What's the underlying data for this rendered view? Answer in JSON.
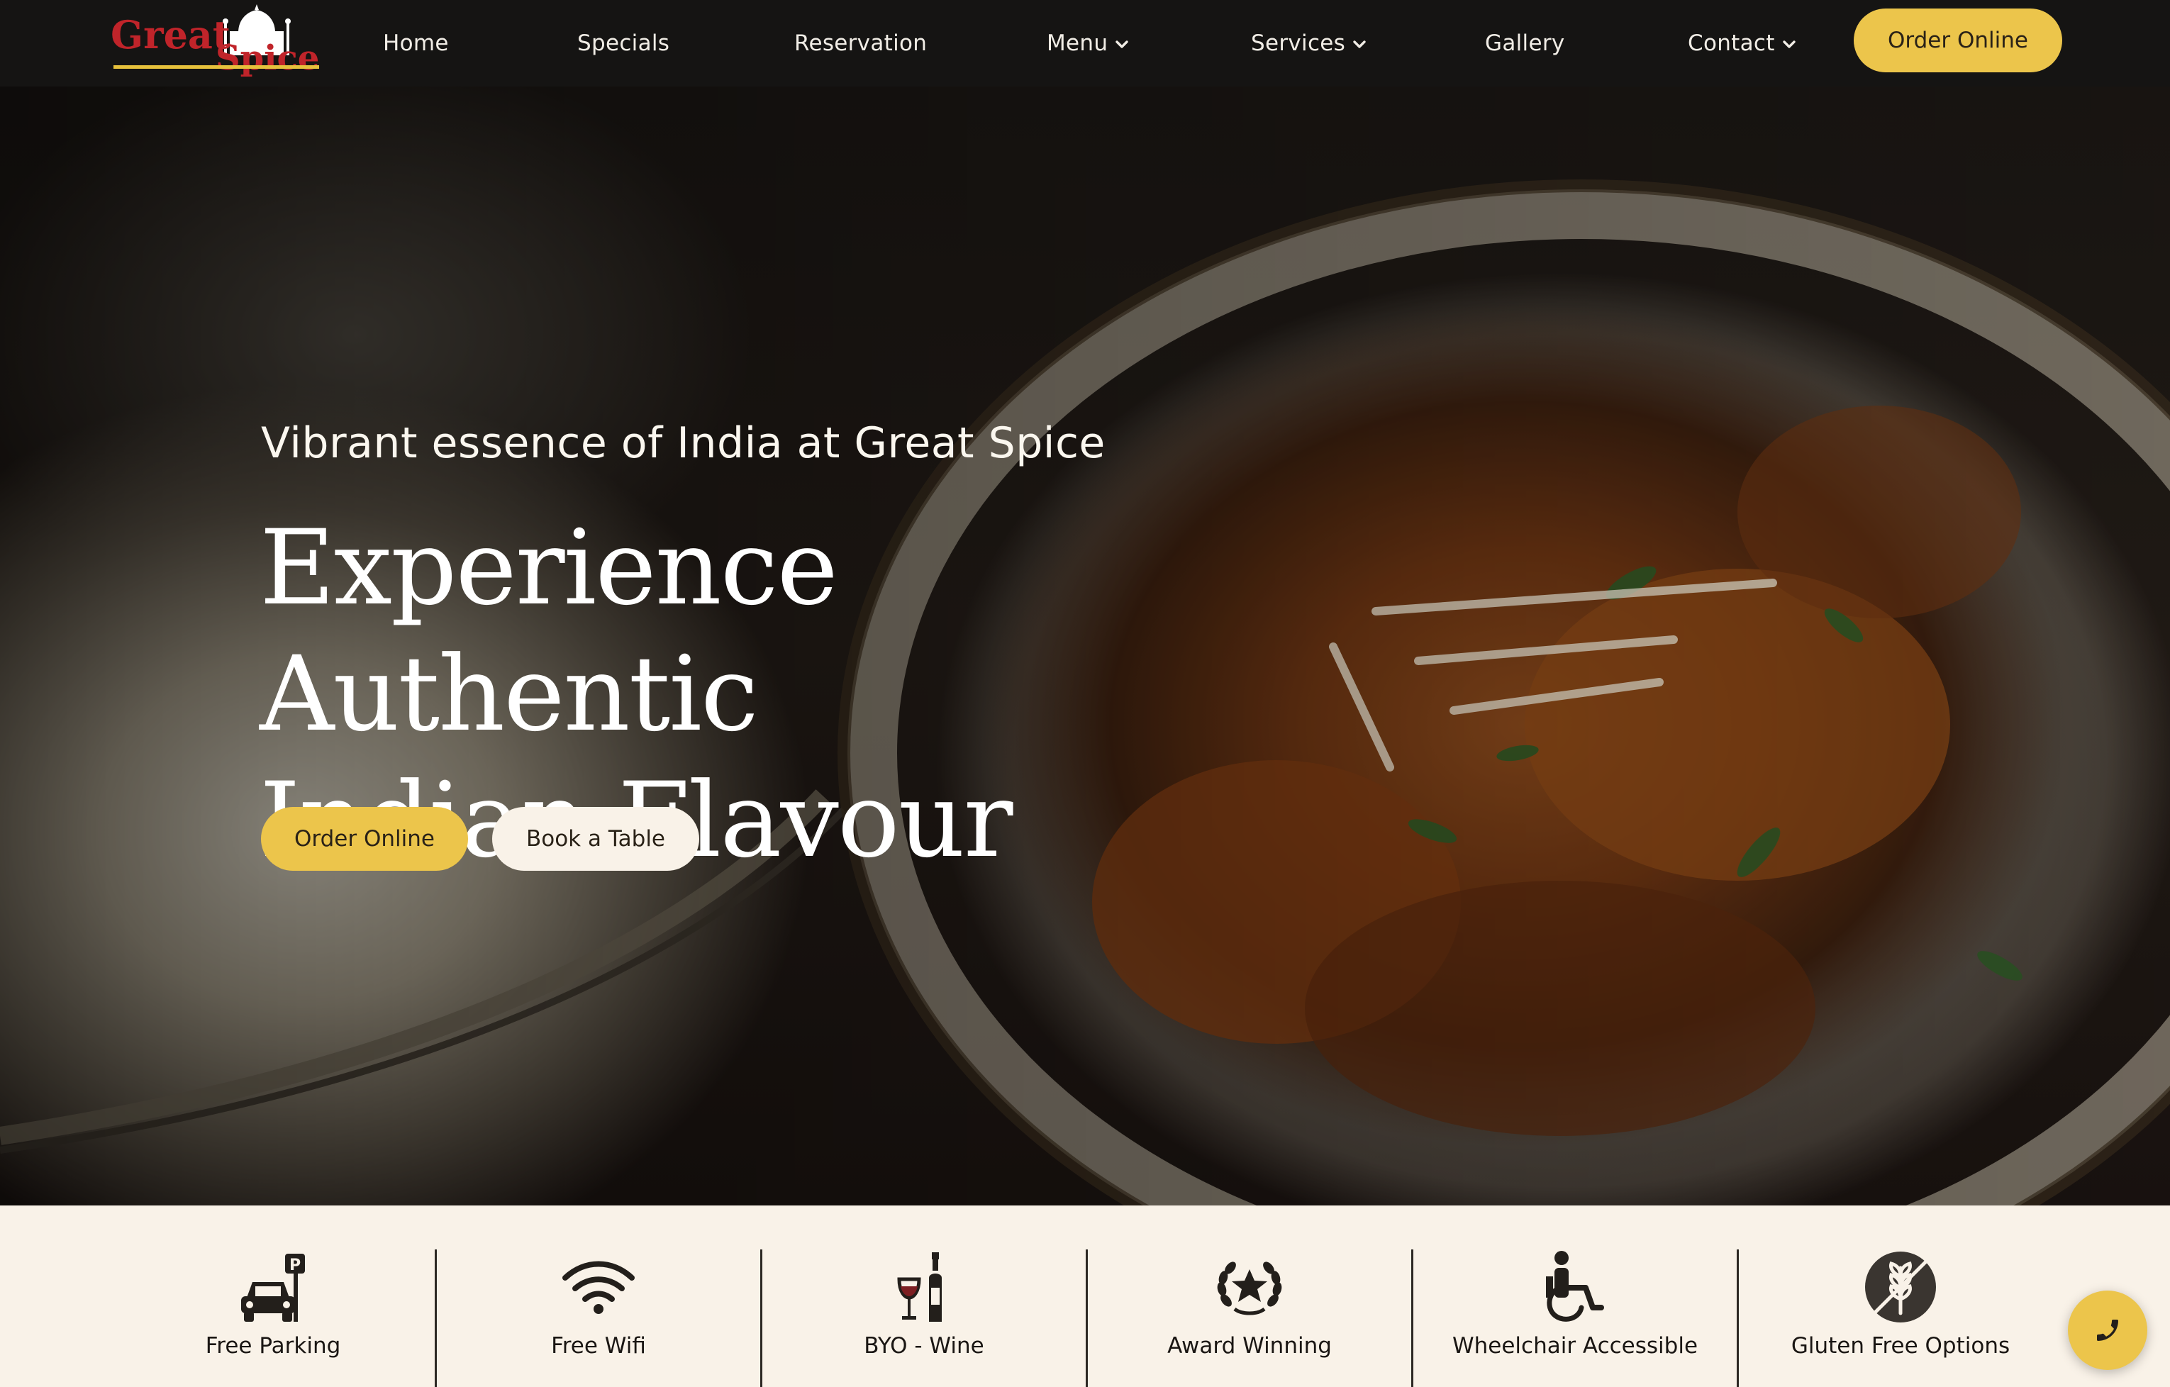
{
  "brand": {
    "logo_text_1": "Great",
    "logo_text_2": "Spice"
  },
  "nav": {
    "items": [
      {
        "label": "Home"
      },
      {
        "label": "Specials"
      },
      {
        "label": "Reservation"
      },
      {
        "label": "Menu",
        "dropdown": true
      },
      {
        "label": "Services",
        "dropdown": true
      },
      {
        "label": "Gallery"
      },
      {
        "label": "Contact",
        "dropdown": true
      }
    ],
    "cta": "Order Online"
  },
  "hero": {
    "subtitle": "Vibrant essence of India at Great Spice",
    "title_line1": "Experience Authentic",
    "title_line2": "Indian Flavour",
    "primary_button": "Order Online",
    "secondary_button": "Book a Table"
  },
  "features": [
    {
      "label": "Free Parking",
      "icon": "car-parking-icon"
    },
    {
      "label": "Free Wifi",
      "icon": "wifi-icon"
    },
    {
      "label": "BYO - Wine",
      "icon": "wine-icon"
    },
    {
      "label": "Award Winning",
      "icon": "award-icon"
    },
    {
      "label": "Wheelchair Accessible",
      "icon": "wheelchair-icon"
    },
    {
      "label": "Gluten Free Options",
      "icon": "gluten-free-icon"
    }
  ],
  "colors": {
    "nav_bg": "#151413",
    "accent_gold": "#ecc54b",
    "features_bg": "#f9f2e8",
    "logo_red": "#c0242a",
    "logo_gold": "#e6c13c"
  },
  "floating": {
    "icon": "phone-icon"
  }
}
